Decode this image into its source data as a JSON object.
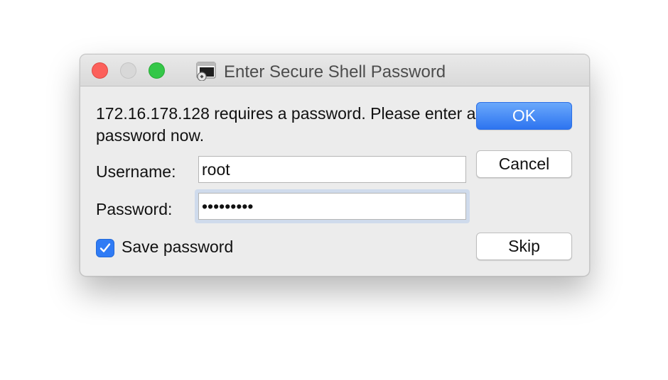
{
  "window": {
    "title": "Enter Secure Shell Password"
  },
  "message": "172.16.178.128 requires a password.  Please enter a password now.",
  "username": {
    "label": "Username:",
    "value": "root"
  },
  "password": {
    "label": "Password:",
    "value": "•••••••••"
  },
  "save_password": {
    "label": "Save password",
    "checked": true
  },
  "buttons": {
    "ok": "OK",
    "cancel": "Cancel",
    "skip": "Skip"
  },
  "colors": {
    "accent": "#2f7bf5",
    "close": "#fc605b",
    "zoom": "#34c748"
  }
}
